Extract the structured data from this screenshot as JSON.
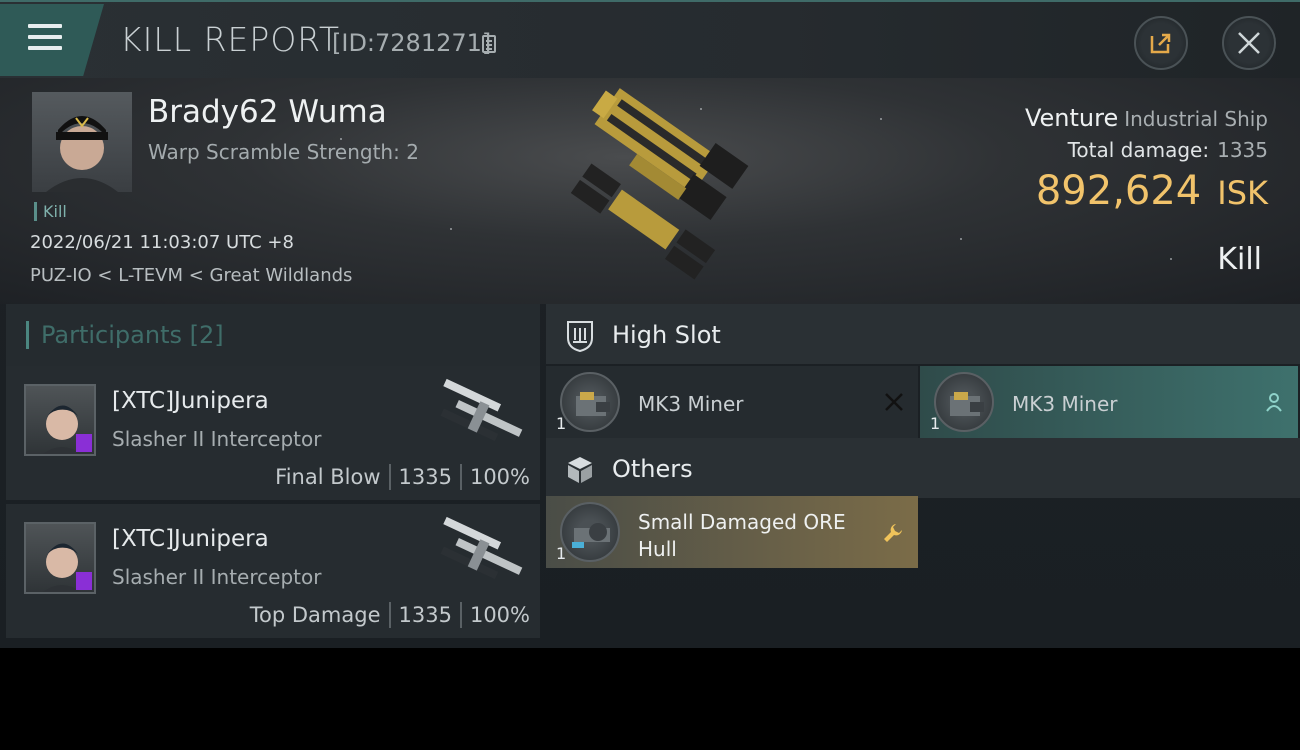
{
  "topbar": {
    "title": "KILL REPORT",
    "report_id": "[ID:7281271]",
    "icons": {
      "menu": "menu-icon",
      "copy": "copy-icon",
      "share": "share-icon",
      "close": "close-icon"
    }
  },
  "victim": {
    "name": "Brady62 Wuma",
    "subtitle": "Warp Scramble Strength: 2",
    "tag": "Kill",
    "datetime": "2022/06/21 11:03:07 UTC +8",
    "location": "PUZ-IO < L-TEVM < Great Wildlands",
    "ship_name": "Venture",
    "ship_class": "Industrial Ship",
    "total_damage_label": "Total damage:",
    "total_damage": "1335",
    "isk_value": "892,624",
    "isk_unit": "ISK",
    "result": "Kill"
  },
  "participants": {
    "title": "Participants",
    "count": "[2]",
    "list": [
      {
        "name": "[XTC]Junipera",
        "ship": "Slasher II Interceptor",
        "role": "Final Blow",
        "damage": "1335",
        "percent": "100%"
      },
      {
        "name": "[XTC]Junipera",
        "ship": "Slasher II Interceptor",
        "role": "Top Damage",
        "damage": "1335",
        "percent": "100%"
      }
    ]
  },
  "slots": {
    "high_slot": {
      "title": "High Slot",
      "items": [
        {
          "name": "MK3 Miner",
          "qty": "1",
          "status": "destroyed"
        },
        {
          "name": "MK3 Miner",
          "qty": "1",
          "status": "dropped"
        }
      ]
    },
    "others": {
      "title": "Others",
      "items": [
        {
          "name": "Small Damaged ORE Hull",
          "qty": "1",
          "status": "salvage"
        }
      ]
    }
  },
  "colors": {
    "accent_teal": "#3e716d",
    "isk_gold": "#f1c36b",
    "salvage": "#7b6c48"
  }
}
